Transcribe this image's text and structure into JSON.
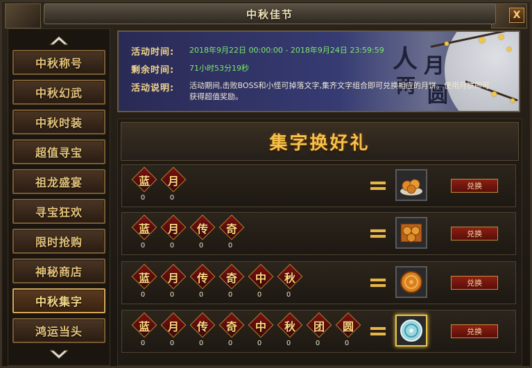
{
  "window": {
    "title": "中秋佳节",
    "close_label": "X"
  },
  "sidebar": {
    "items": [
      {
        "label": "中秋称号"
      },
      {
        "label": "中秋幻武"
      },
      {
        "label": "中秋时装"
      },
      {
        "label": "超值寻宝"
      },
      {
        "label": "祖龙盛宴"
      },
      {
        "label": "寻宝狂欢"
      },
      {
        "label": "限时抢购"
      },
      {
        "label": "神秘商店"
      },
      {
        "label": "中秋集字",
        "active": true
      },
      {
        "label": "鸿运当头"
      }
    ]
  },
  "banner": {
    "time_label": "活动时间:",
    "time_value": "2018年9月22日 00:00:00 - 2018年9月24日 23:59:59",
    "remain_label": "剩余时间:",
    "remain_value": "71小时53分19秒",
    "desc_label": "活动说明:",
    "desc_value": "活动期间,击败BOSS和小怪可掉落文字,集齐文字组合即可兑换相应的月饼。使用月饼即可获得超值奖励。",
    "art_text": [
      "人",
      "月",
      "两",
      "圆"
    ]
  },
  "main": {
    "heading": "集字换好礼",
    "rows": [
      {
        "chars": [
          "蓝",
          "月"
        ],
        "counts": [
          "0",
          "0"
        ],
        "button": "兑换",
        "reward_icon": "mooncake-plate-icon"
      },
      {
        "chars": [
          "蓝",
          "月",
          "传",
          "奇"
        ],
        "counts": [
          "0",
          "0",
          "0",
          "0"
        ],
        "button": "兑换",
        "reward_icon": "mooncake-box-icon"
      },
      {
        "chars": [
          "蓝",
          "月",
          "传",
          "奇",
          "中",
          "秋"
        ],
        "counts": [
          "0",
          "0",
          "0",
          "0",
          "0",
          "0"
        ],
        "button": "兑换",
        "reward_icon": "mooncake-icon"
      },
      {
        "chars": [
          "蓝",
          "月",
          "传",
          "奇",
          "中",
          "秋",
          "团",
          "圆"
        ],
        "counts": [
          "0",
          "0",
          "0",
          "0",
          "0",
          "0",
          "0",
          "0"
        ],
        "button": "兑换",
        "reward_icon": "jade-mooncake-icon"
      }
    ]
  },
  "colors": {
    "gold": "#f5c24a",
    "green_text": "#7de86f",
    "button_red": "#8a1f14"
  }
}
